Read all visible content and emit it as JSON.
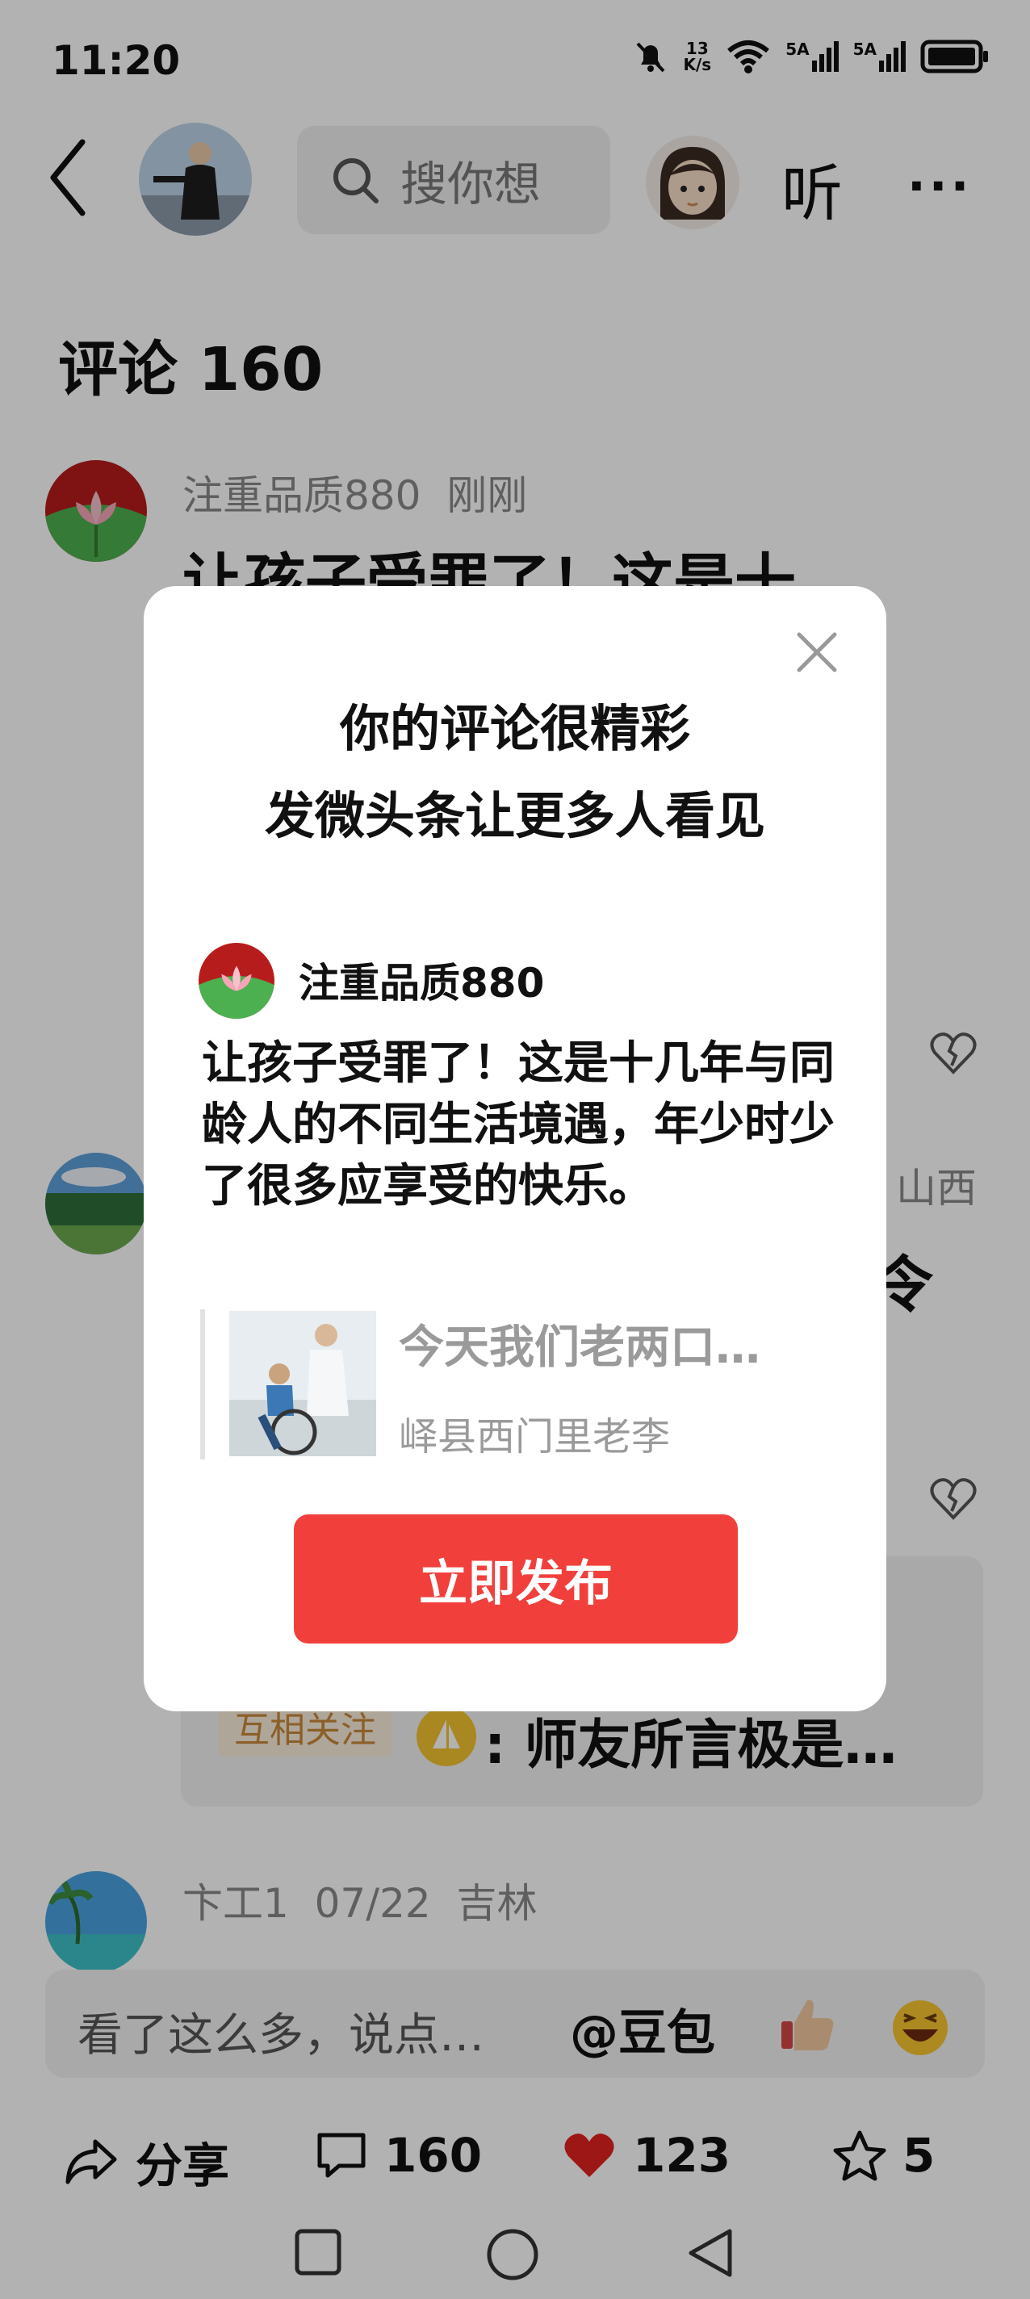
{
  "status_bar": {
    "time": "11:20",
    "net_speed_value": "13",
    "net_speed_unit": "K/s",
    "sim1": "5A",
    "sim2": "5A"
  },
  "header": {
    "search_placeholder": "搜你想",
    "listen_label": "听",
    "more_label": "···"
  },
  "comments": {
    "title": "评论 160",
    "items": [
      {
        "user": "注重品质880",
        "time": "刚刚",
        "location": "",
        "text_visible": "让孩子受罪了！这是十"
      },
      {
        "user": "",
        "time": "",
        "location": "山西",
        "text_visible": "令"
      },
      {
        "user": "卞工1",
        "time": "07/22",
        "location": "吉林",
        "text_visible": ""
      }
    ],
    "reply": {
      "tag": "互相关注",
      "text": ": 师友所言极是…"
    }
  },
  "modal": {
    "title_line1": "你的评论很精彩",
    "title_line2": "发微头条让更多人看见",
    "user": "注重品质880",
    "comment": "让孩子受罪了！这是十几年与同龄人的不同生活境遇，年少时少了很多应享受的快乐。",
    "quote_title": "今天我们老两口…",
    "quote_author": "峄县西门里老李",
    "publish_label": "立即发布"
  },
  "input_bar": {
    "placeholder": "看了这么多，说点…",
    "doubao": "@豆包"
  },
  "actions": {
    "share_label": "分享",
    "comment_count": "160",
    "like_count": "123",
    "fav_count": "5"
  },
  "colors": {
    "accent_red": "#f1403c",
    "heart_red": "#e0211f",
    "tag_orange": "#c9883c"
  }
}
